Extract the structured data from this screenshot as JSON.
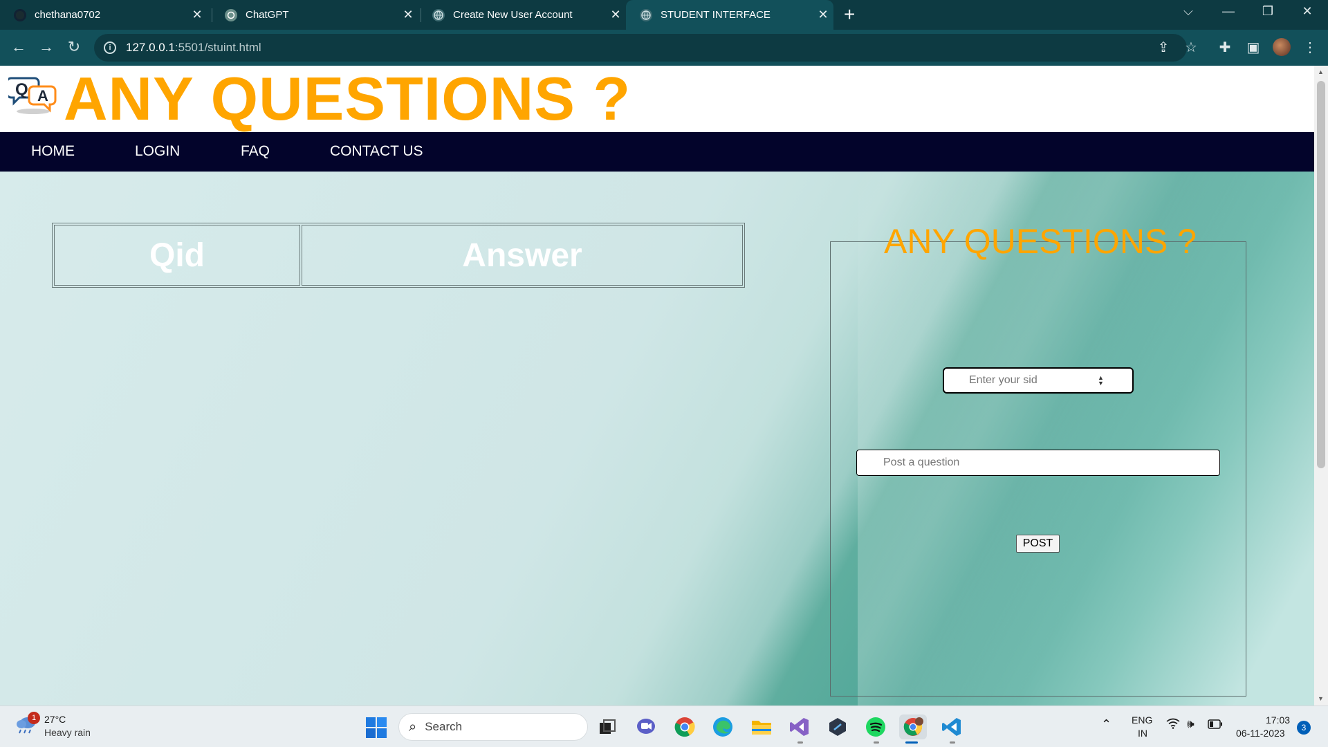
{
  "browser": {
    "tabs": [
      {
        "title": "chethana0702",
        "icon": "github-icon",
        "active": false
      },
      {
        "title": "ChatGPT",
        "icon": "chatgpt-icon",
        "active": false
      },
      {
        "title": "Create New User Account",
        "icon": "globe-icon",
        "active": false
      },
      {
        "title": "STUDENT INTERFACE",
        "icon": "globe-icon",
        "active": true
      }
    ],
    "url_host": "127.0.0.1",
    "url_rest": ":5501/stuint.html"
  },
  "page": {
    "site_title": "ANY QUESTIONS ?",
    "logo_letters": {
      "q": "Q",
      "a": "A"
    },
    "nav": [
      "HOME",
      "LOGIN",
      "FAQ",
      "CONTACT US"
    ],
    "table_headers": [
      "Qid",
      "Answer"
    ],
    "form": {
      "legend": "ANY QUESTIONS ?",
      "sid_placeholder": "Enter your sid",
      "question_placeholder": "Post a question",
      "post_label": "POST"
    },
    "colors": {
      "accent": "#ffa500",
      "nav_bg": "#03042b"
    }
  },
  "taskbar": {
    "weather": {
      "badge": "1",
      "temp": "27°C",
      "desc": "Heavy rain"
    },
    "search_label": "Search",
    "lang_top": "ENG",
    "lang_bottom": "IN",
    "time": "17:03",
    "date": "06-11-2023",
    "notifications": "3"
  }
}
